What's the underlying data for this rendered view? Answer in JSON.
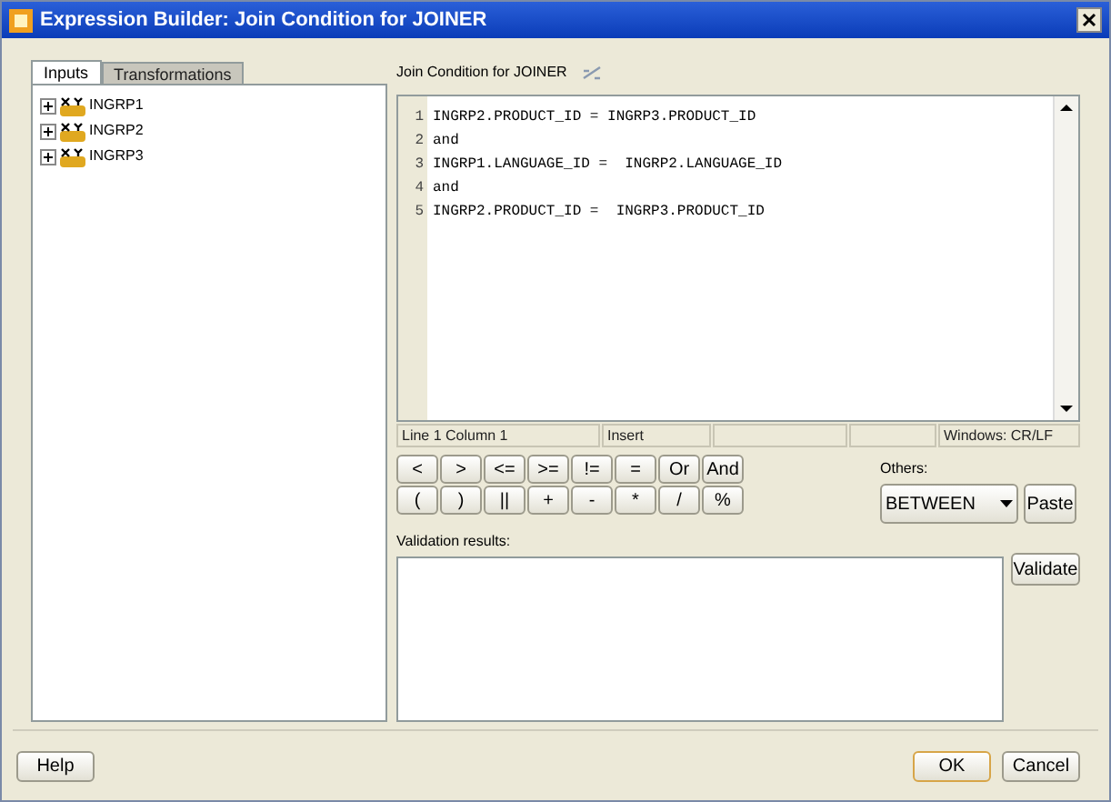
{
  "window": {
    "title": "Expression Builder: Join Condition for JOINER"
  },
  "tabs": [
    {
      "label": "Inputs",
      "selected": true
    },
    {
      "label": "Transformations",
      "selected": false
    }
  ],
  "tree": [
    {
      "label": "INGRP1",
      "expanded": false
    },
    {
      "label": "INGRP2",
      "expanded": false
    },
    {
      "label": "INGRP3",
      "expanded": false
    }
  ],
  "editor": {
    "title": "Join Condition for JOINER",
    "lines": [
      {
        "number": "1",
        "text": "INGRP2.PRODUCT_ID = INGRP3.PRODUCT_ID"
      },
      {
        "number": "2",
        "text": "and"
      },
      {
        "number": "3",
        "text": "INGRP1.LANGUAGE_ID =  INGRP2.LANGUAGE_ID"
      },
      {
        "number": "4",
        "text": "and"
      },
      {
        "number": "5",
        "text": "INGRP2.PRODUCT_ID =  INGRP3.PRODUCT_ID"
      }
    ]
  },
  "status_bar": {
    "position": "Line 1 Column 1",
    "mode": "Insert",
    "line_ending": "Windows: CR/LF"
  },
  "operators": [
    [
      "<",
      ">",
      "<=",
      ">=",
      "!=",
      "=",
      "Or",
      "And"
    ],
    [
      "(",
      ")",
      "||",
      "+",
      "-",
      "*",
      "/",
      "%"
    ]
  ],
  "others": {
    "label": "Others:",
    "value": "BETWEEN",
    "button": "Paste"
  },
  "validation": {
    "label": "Validation results:",
    "button": "Validate"
  },
  "buttons": {
    "help": "Help",
    "ok": "OK",
    "cancel": "Cancel"
  }
}
